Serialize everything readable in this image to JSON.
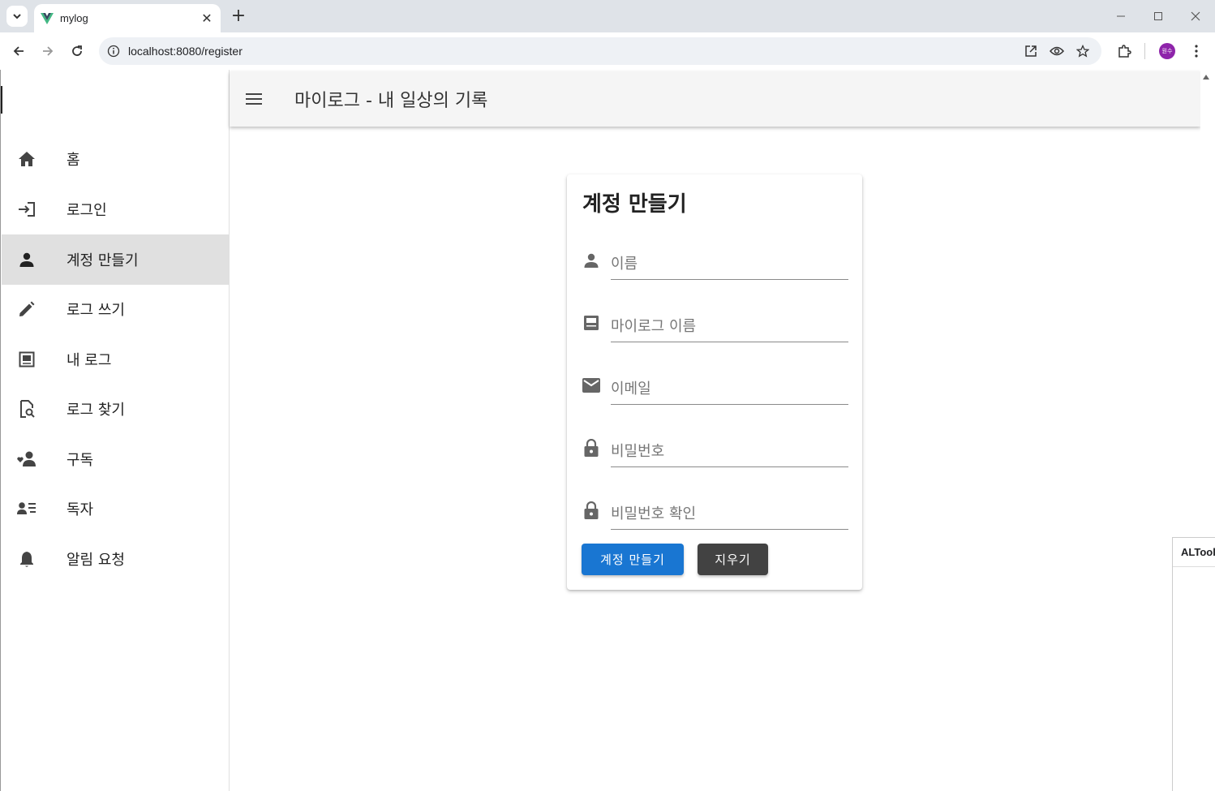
{
  "browser": {
    "tab_title": "mylog",
    "url": "localhost:8080/register",
    "profile_initials": "원수"
  },
  "app": {
    "title": "마이로그 - 내 일상의 기록"
  },
  "sidebar": {
    "items": [
      {
        "label": "홈",
        "icon": "home-icon"
      },
      {
        "label": "로그인",
        "icon": "login-icon"
      },
      {
        "label": "계정 만들기",
        "icon": "person-icon",
        "active": true
      },
      {
        "label": "로그 쓰기",
        "icon": "pencil-icon"
      },
      {
        "label": "내 로그",
        "icon": "article-icon"
      },
      {
        "label": "로그 찾기",
        "icon": "find-in-page-icon"
      },
      {
        "label": "구독",
        "icon": "favorite-person-icon"
      },
      {
        "label": "독자",
        "icon": "person-list-icon"
      },
      {
        "label": "알림 요청",
        "icon": "bell-icon"
      }
    ]
  },
  "form": {
    "title": "계정 만들기",
    "fields": [
      {
        "placeholder": "이름",
        "value": "",
        "icon": "person-icon"
      },
      {
        "placeholder": "마이로그 이름",
        "value": "",
        "icon": "blog-icon"
      },
      {
        "placeholder": "이메일",
        "value": "",
        "icon": "mail-icon"
      },
      {
        "placeholder": "비밀번호",
        "value": "",
        "icon": "lock-icon"
      },
      {
        "placeholder": "비밀번호 확인",
        "value": "",
        "icon": "lock-icon"
      }
    ],
    "submit_label": "계정 만들기",
    "clear_label": "지우기"
  },
  "extension_panel": {
    "title": "ALTools"
  },
  "colors": {
    "primary": "#1976d2",
    "dark_button": "#424242",
    "active_nav": "#e0e0e0",
    "appbar": "#f5f5f5"
  }
}
